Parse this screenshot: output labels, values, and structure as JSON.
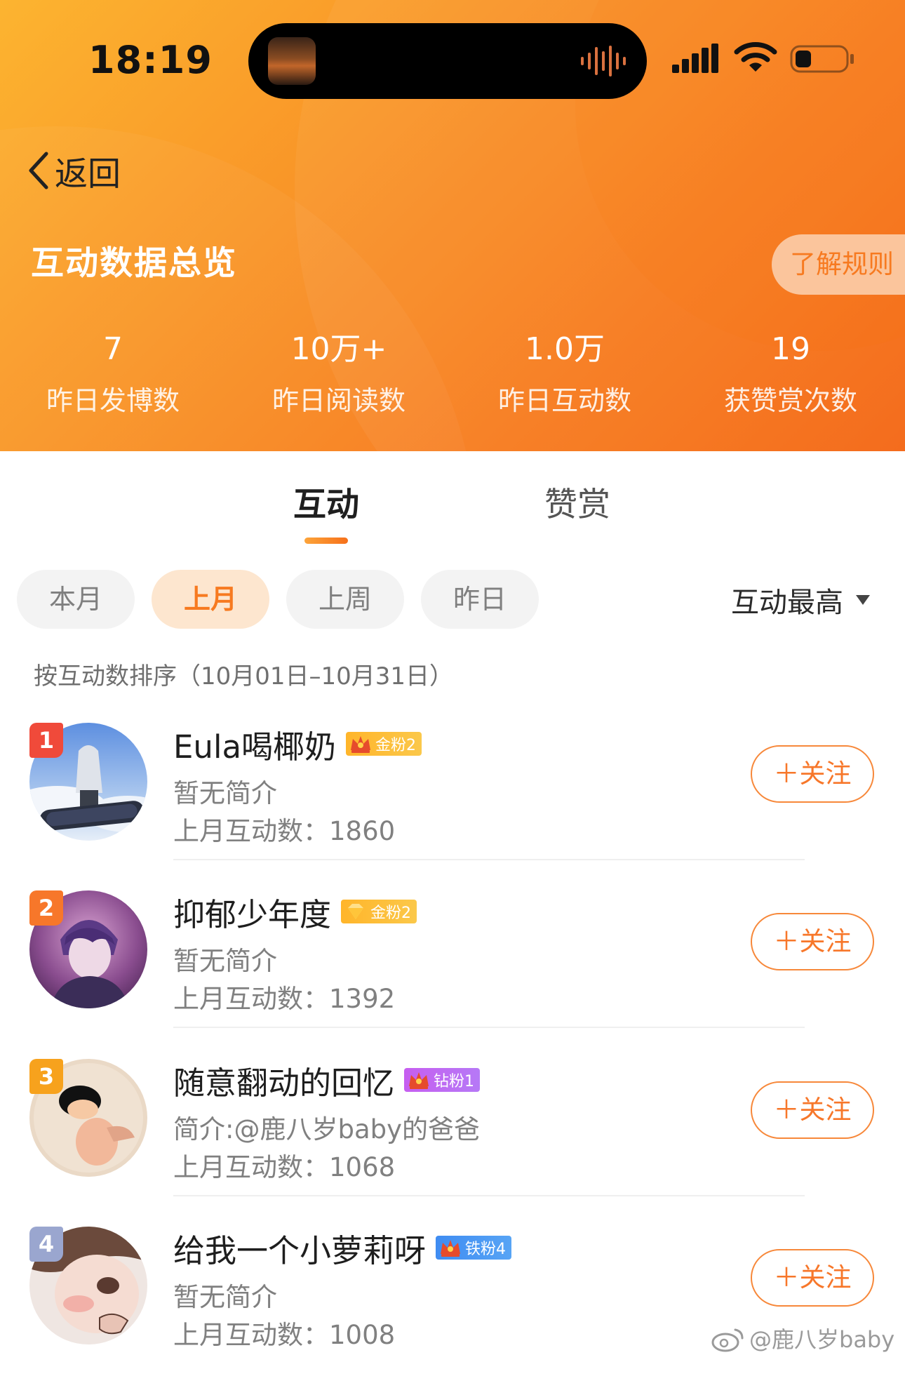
{
  "status_bar": {
    "time": "18:19"
  },
  "nav": {
    "back_label": "返回"
  },
  "overview": {
    "title": "互动数据总览",
    "rules_label": "了解规则",
    "stats": [
      {
        "value": "7",
        "label": "昨日发博数"
      },
      {
        "value": "10万+",
        "label": "昨日阅读数"
      },
      {
        "value": "1.0万",
        "label": "昨日互动数"
      },
      {
        "value": "19",
        "label": "获赞赏次数"
      }
    ]
  },
  "tabs": [
    {
      "label": "互动",
      "active": true
    },
    {
      "label": "赞赏",
      "active": false
    }
  ],
  "filters": {
    "chips": [
      {
        "label": "本月",
        "selected": false
      },
      {
        "label": "上月",
        "selected": true
      },
      {
        "label": "上周",
        "selected": false
      },
      {
        "label": "昨日",
        "selected": false
      }
    ],
    "sort_label": "互动最高"
  },
  "range_note": "按互动数排序（10月01日–10月31日）",
  "users": [
    {
      "rank": "1",
      "rank_color": "#f04a3a",
      "name": "Eula喝椰奶",
      "badge": "金粉2",
      "badge_type": "gold",
      "bio": "暂无简介",
      "count_label": "上月互动数：",
      "count": "1860",
      "follow_label": "＋关注"
    },
    {
      "rank": "2",
      "rank_color": "#f7772a",
      "name": "抑郁少年度",
      "badge": "金粉2",
      "badge_type": "gold",
      "bio": "暂无简介",
      "count_label": "上月互动数：",
      "count": "1392",
      "follow_label": "＋关注"
    },
    {
      "rank": "3",
      "rank_color": "#f7a21d",
      "name": "随意翻动的回忆",
      "badge": "钻粉1",
      "badge_type": "diamond",
      "bio": "简介:@鹿八岁baby的爸爸",
      "count_label": "上月互动数：",
      "count": "1068",
      "follow_label": "＋关注"
    },
    {
      "rank": "4",
      "rank_color": "#9aa6cf",
      "name": "给我一个小萝莉呀",
      "badge": "铁粉4",
      "badge_type": "iron",
      "bio": "暂无简介",
      "count_label": "上月互动数：",
      "count": "1008",
      "follow_label": "＋关注"
    }
  ],
  "watermark": "@鹿八岁baby",
  "colors": {
    "accent": "#f77a20",
    "header_start": "#fcb430",
    "header_end": "#f46511"
  }
}
